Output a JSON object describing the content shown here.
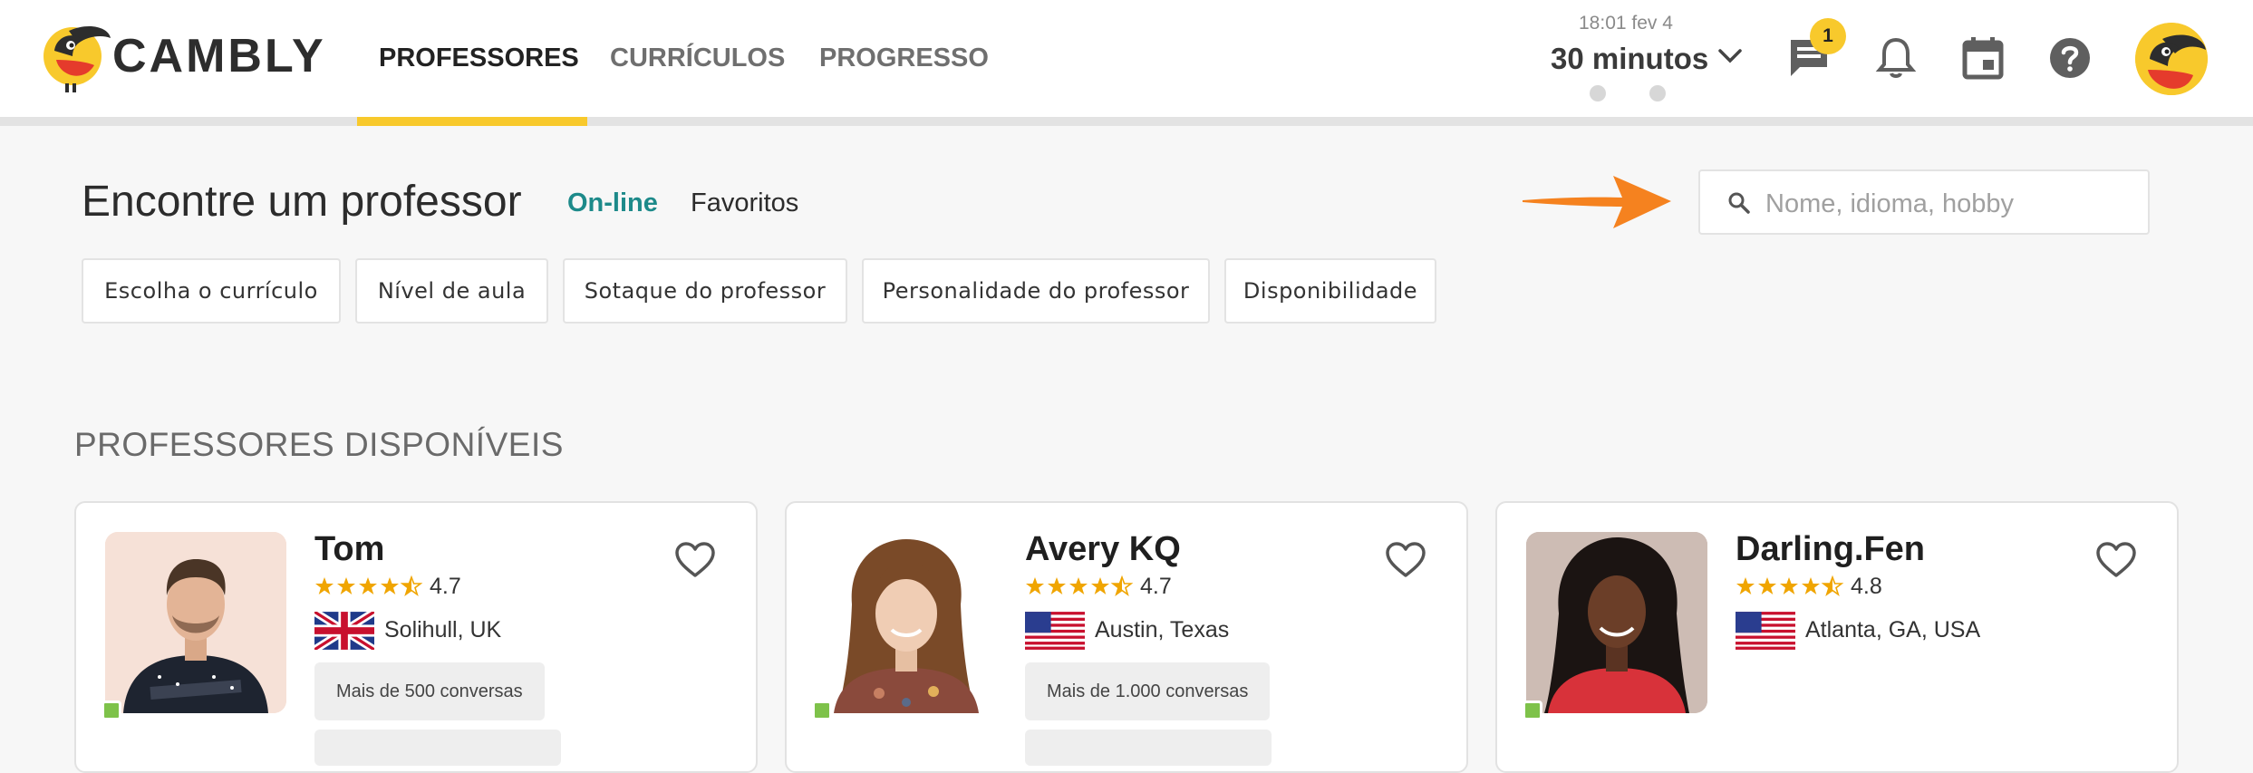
{
  "brand": {
    "name": "CAMBLY"
  },
  "nav": {
    "items": [
      {
        "label": "PROFESSORES",
        "active": true
      },
      {
        "label": "CURRÍCULOS",
        "active": false
      },
      {
        "label": "PROGRESSO",
        "active": false
      }
    ]
  },
  "session": {
    "time": "18:01 fev 4",
    "duration": "30 minutos"
  },
  "messages": {
    "badge_count": "1"
  },
  "search_section": {
    "title": "Encontre um professor",
    "tabs": [
      {
        "label": "On-line",
        "active": true
      },
      {
        "label": "Favoritos",
        "active": false
      }
    ],
    "search_placeholder": "Nome, idioma, hobby",
    "filters": [
      "Escolha o currículo",
      "Nível de aula",
      "Sotaque do professor",
      "Personalidade do professor",
      "Disponibilidade"
    ]
  },
  "available": {
    "title": "PROFESSORES DISPONÍVEIS"
  },
  "teachers": [
    {
      "name": "Tom",
      "rating": "4.7",
      "location": "Solihull, UK",
      "flag": "uk-flag",
      "conversations": "Mais de 500 conversas",
      "online": true
    },
    {
      "name": "Avery KQ",
      "rating": "4.7",
      "location": "Austin, Texas",
      "flag": "us-flag",
      "conversations": "Mais de 1.000 conversas",
      "online": true
    },
    {
      "name": "Darling.Fen",
      "rating": "4.8",
      "location": "Atlanta, GA, USA",
      "flag": "us-flag",
      "conversations": "",
      "online": true
    }
  ],
  "colors": {
    "accent": "#f8c92c",
    "online_tab": "#1d8a8a",
    "online_status": "#7ec24a",
    "star": "#f0a500",
    "arrow": "#f5821f"
  }
}
